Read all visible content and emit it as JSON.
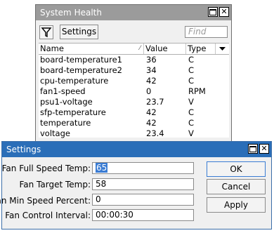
{
  "health_window": {
    "title": "System Health",
    "settings_button": "Settings",
    "find_placeholder": "Find",
    "columns": {
      "name": "Name",
      "value": "Value",
      "type": "Type"
    },
    "rows": [
      {
        "name": "board-temperature1",
        "value": "36",
        "type": "C"
      },
      {
        "name": "board-temperature2",
        "value": "34",
        "type": "C"
      },
      {
        "name": "cpu-temperature",
        "value": "42",
        "type": "C"
      },
      {
        "name": "fan1-speed",
        "value": "0",
        "type": "RPM"
      },
      {
        "name": "psu1-voltage",
        "value": "23.7",
        "type": "V"
      },
      {
        "name": "sfp-temperature",
        "value": "42",
        "type": "C"
      },
      {
        "name": "temperature",
        "value": "42",
        "type": "C"
      },
      {
        "name": "voltage",
        "value": "23.4",
        "type": "V"
      }
    ]
  },
  "settings_dialog": {
    "title": "Settings",
    "fields": [
      {
        "label": "Fan Full Speed Temp:",
        "value": "65"
      },
      {
        "label": "Fan Target Temp:",
        "value": "58"
      },
      {
        "label": "Fan Min Speed Percent:",
        "value": "0"
      },
      {
        "label": "Fan Control Interval:",
        "value": "00:00:30"
      }
    ],
    "ok": "OK",
    "cancel": "Cancel",
    "apply": "Apply"
  }
}
